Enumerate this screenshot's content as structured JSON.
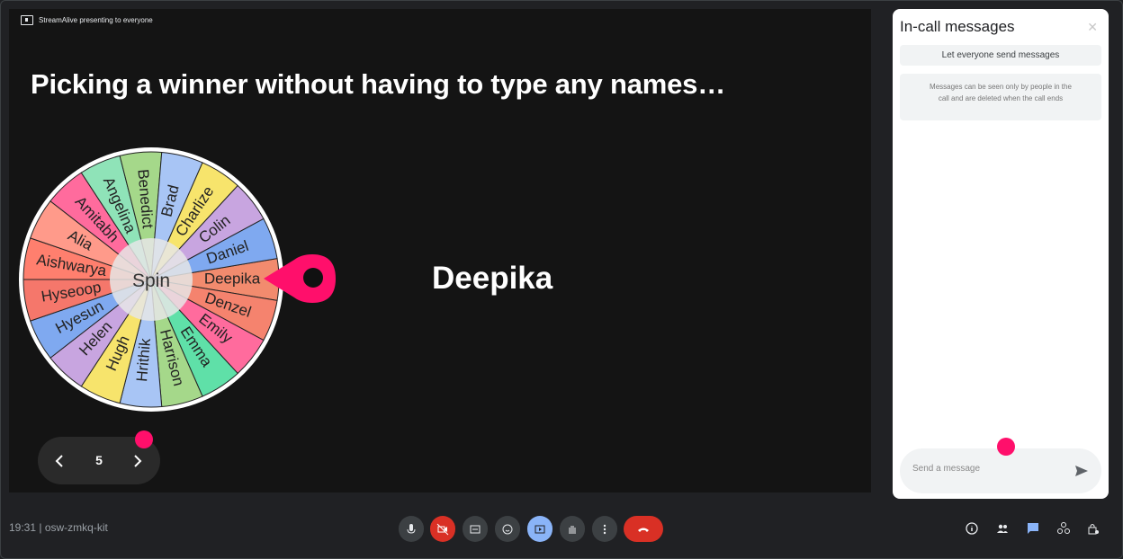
{
  "presenting_label": "StreamAlive presenting to everyone",
  "headline": "Picking a winner without having to type any names…",
  "wheel": {
    "center_label": "Spin",
    "names": [
      "Deepika",
      "Denzel",
      "Emily",
      "Emma",
      "Harrison",
      "Hrithik",
      "Hugh",
      "Helen",
      "Hyesun",
      "Hyseoop",
      "Aishwarya",
      "Alia",
      "Amitabh",
      "Angelina",
      "Benedict",
      "Brad",
      "Charlize",
      "Colin",
      "Daniel"
    ],
    "colors": [
      "#f28b6e",
      "#f5836e",
      "#ff6b9d",
      "#5fe0a8",
      "#a5d88a",
      "#a8c5f5",
      "#f7e46c",
      "#c8a5e0",
      "#7fa9f0",
      "#f5776b",
      "#ff7f6e",
      "#ff9a8a",
      "#ff6b9d",
      "#8fe3b8",
      "#a5d88a",
      "#a8c5f5",
      "#f7e46c",
      "#c8a5e0",
      "#7fa9f0"
    ],
    "pointer_color": "#ff0f6b"
  },
  "winner": "Deepika",
  "pager": {
    "page": "5"
  },
  "messages_panel": {
    "title": "In-call messages",
    "toggle_label": "Let everyone send messages",
    "info": "Messages can be seen only by people in the call and are deleted when the call ends",
    "input_placeholder": "Send a message"
  },
  "bottom_bar": {
    "meeting_info": "19:31 | osw-zmkq-kit"
  },
  "colors": {
    "accent": "#ff0f6b",
    "end_call": "#d93025",
    "present_active": "#8ab4f8"
  }
}
